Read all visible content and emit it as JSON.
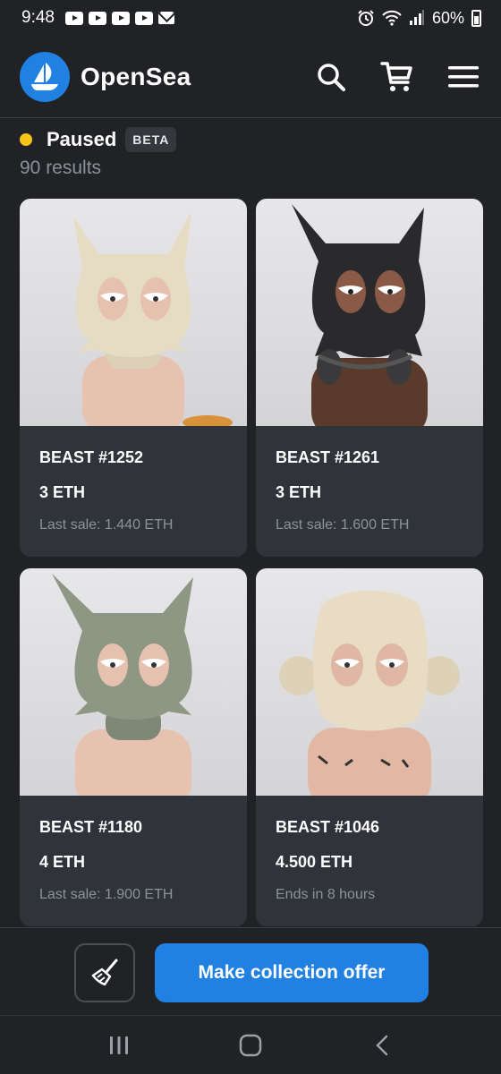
{
  "status_bar": {
    "time": "9:48",
    "battery": "60%",
    "icons": [
      "youtube-icon",
      "youtube-icon",
      "youtube-icon",
      "youtube-icon",
      "mail-icon",
      "alarm-icon",
      "wifi-icon",
      "signal-icon",
      "battery-icon"
    ]
  },
  "header": {
    "brand": "OpenSea",
    "logo_color": "#2081e2",
    "icons": [
      "search-icon",
      "cart-icon",
      "menu-icon"
    ]
  },
  "collection": {
    "state": "Paused",
    "state_color": "#f5c518",
    "badge": "BETA",
    "results": "90 results"
  },
  "items": [
    {
      "name": "BEAST #1252",
      "price": "3 ETH",
      "sub": "Last sale: 1.440 ETH",
      "mask_color": "#e6dcc4",
      "body_color": "#e8c2b0"
    },
    {
      "name": "BEAST #1261",
      "price": "3 ETH",
      "sub": "Last sale: 1.600 ETH",
      "mask_color": "#2a2a2c",
      "body_color": "#5a3b2b"
    },
    {
      "name": "BEAST #1180",
      "price": "4 ETH",
      "sub": "Last sale: 1.900 ETH",
      "mask_color": "#8e9684",
      "body_color": "#e8c2b0"
    },
    {
      "name": "BEAST #1046",
      "price": "4.500 ETH",
      "sub": "Ends in 8 hours",
      "mask_color": "#e8dcc4",
      "body_color": "#e2b7a3"
    }
  ],
  "footer": {
    "offer_button": "Make collection offer",
    "accent": "#2081e2"
  }
}
